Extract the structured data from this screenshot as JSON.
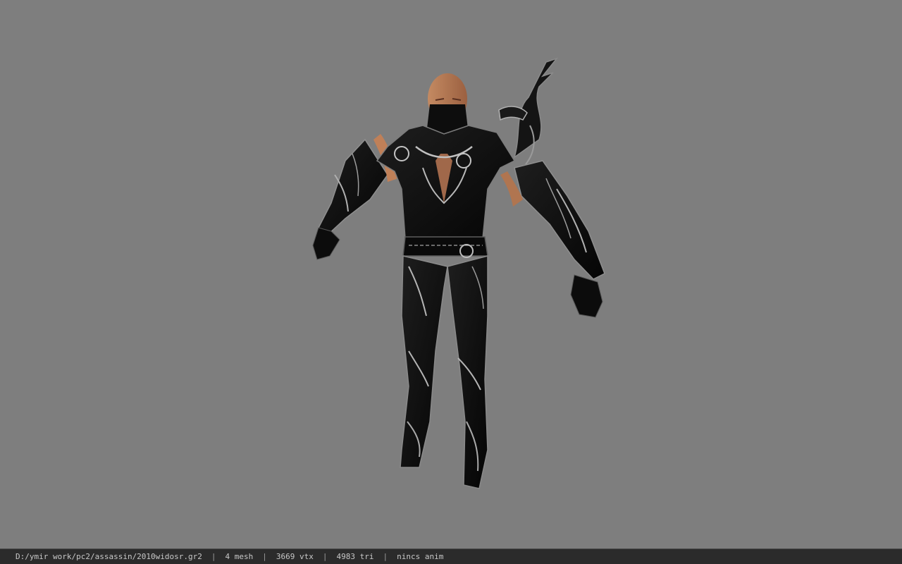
{
  "status": {
    "file_path": "D:/ymir work/pc2/assassin/2010widosr.gr2",
    "mesh": "4 mesh",
    "vertices": "3669 vtx",
    "triangles": "4983 tri",
    "animation": "nincs anim",
    "separator": "|"
  },
  "colors": {
    "viewport_background": "#7e7e7e",
    "statusbar_background": "#2b2b2b",
    "statusbar_text": "#c8c8c8",
    "armor_dark": "#111111",
    "armor_silver": "#a8a8a8",
    "skin": "#b57a55"
  }
}
